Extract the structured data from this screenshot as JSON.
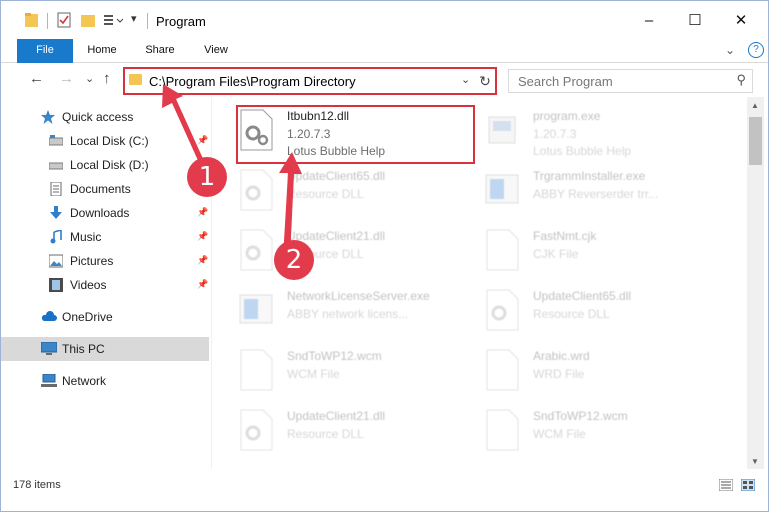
{
  "window": {
    "title": "Program",
    "minimize_label": "–",
    "maximize_label": "☐",
    "close_label": "✕"
  },
  "ribbon": {
    "tabs": [
      "File",
      "Home",
      "Share",
      "View"
    ],
    "expand_label": "⌄",
    "help_label": "?"
  },
  "nav": {
    "back": "←",
    "forward": "→",
    "recent": "⌄",
    "up": "↑"
  },
  "address": {
    "path": "C:\\Program Files\\Program Directory",
    "chevron": "⌄",
    "refresh": "↻"
  },
  "search": {
    "placeholder": "Search Program",
    "icon": "⚲"
  },
  "sidebar": {
    "items": [
      {
        "label": "Quick access",
        "icon": "star-icon",
        "pinned": false
      },
      {
        "label": "Local Disk (C:)",
        "icon": "drive-icon",
        "pinned": true
      },
      {
        "label": "Local Disk (D:)",
        "icon": "drive-icon",
        "pinned": false
      },
      {
        "label": "Documents",
        "icon": "documents-icon",
        "pinned": false
      },
      {
        "label": "Downloads",
        "icon": "download-icon",
        "pinned": true
      },
      {
        "label": "Music",
        "icon": "music-icon",
        "pinned": true
      },
      {
        "label": "Pictures",
        "icon": "pictures-icon",
        "pinned": true
      },
      {
        "label": "Videos",
        "icon": "videos-icon",
        "pinned": true
      },
      {
        "label": "OneDrive",
        "icon": "cloud-icon",
        "pinned": false
      },
      {
        "label": "This PC",
        "icon": "pc-icon",
        "pinned": false,
        "selected": true
      },
      {
        "label": "Network",
        "icon": "network-icon",
        "pinned": false
      }
    ]
  },
  "files": [
    {
      "name": "Itbubn12.dll",
      "version": "1.20.7.3",
      "type": "Lotus Bubble Help",
      "icon": "dll-gear-icon",
      "highlighted": true
    },
    {
      "name": "program.exe",
      "version": "1.20.7.3",
      "type": "Lotus Bubble Help",
      "icon": "exe-icon"
    },
    {
      "name": "UpdateClient65.dll",
      "version": "",
      "type": "Resource DLL",
      "icon": "dll-gear-icon"
    },
    {
      "name": "TrgrammInstaller.exe",
      "version": "",
      "type": "ABBY Reverserder trr...",
      "icon": "window-icon"
    },
    {
      "name": "UpdateClient21.dll",
      "version": "",
      "type": "Resource DLL",
      "icon": "dll-gear-icon"
    },
    {
      "name": "FastNmt.cjk",
      "version": "",
      "type": "CJK File",
      "icon": "blank-file-icon"
    },
    {
      "name": "NetworkLicenseServer.exe",
      "version": "",
      "type": "ABBY network licens...",
      "icon": "window-icon"
    },
    {
      "name": "UpdateClient65.dll",
      "version": "",
      "type": "Resource DLL",
      "icon": "dll-gear-icon"
    },
    {
      "name": "SndToWP12.wcm",
      "version": "",
      "type": "WCM File",
      "icon": "blank-file-icon"
    },
    {
      "name": "Arabic.wrd",
      "version": "",
      "type": "WRD File",
      "icon": "blank-file-icon"
    },
    {
      "name": "UpdateClient21.dll",
      "version": "",
      "type": "Resource DLL",
      "icon": "dll-gear-icon"
    },
    {
      "name": "SndToWP12.wcm",
      "version": "",
      "type": "WCM File",
      "icon": "blank-file-icon"
    }
  ],
  "status": {
    "item_count": "178 items"
  },
  "annotations": {
    "step1": "1",
    "step2": "2",
    "color": "#e23b4c"
  }
}
